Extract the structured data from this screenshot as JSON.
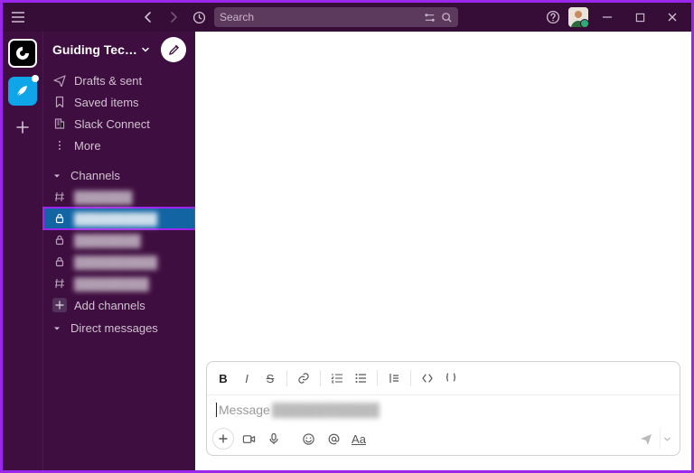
{
  "titlebar": {
    "search_placeholder": "Search"
  },
  "workspace": {
    "name": "Guiding Tec…",
    "badge": "G"
  },
  "sidebar": {
    "nav": {
      "drafts": "Drafts & sent",
      "saved": "Saved items",
      "connect": "Slack Connect",
      "more": "More"
    },
    "channels": {
      "header": "Channels",
      "items": [
        {
          "icon": "hash",
          "label": "███████"
        },
        {
          "icon": "lock",
          "label": "██████████",
          "selected": true
        },
        {
          "icon": "lock",
          "label": "████████"
        },
        {
          "icon": "lock",
          "label": "██████████"
        },
        {
          "icon": "hash",
          "label": "█████████"
        }
      ],
      "add": "Add channels"
    },
    "dms": {
      "header": "Direct messages"
    }
  },
  "composer": {
    "placeholder_prefix": "Message",
    "placeholder_blur": "████████████",
    "aa_label": "Aa"
  }
}
